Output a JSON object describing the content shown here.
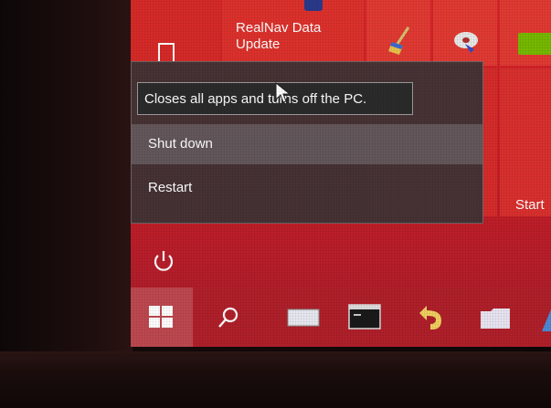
{
  "tiles": {
    "realnav_title_line1": "RealNav Data",
    "realnav_title_line2": "Update",
    "start_label": "Start"
  },
  "power_menu": {
    "tooltip": "Closes all apps and turns off the PC.",
    "items": [
      {
        "label": "Shut down"
      },
      {
        "label": "Restart"
      }
    ]
  },
  "icons": {
    "power": "power-icon",
    "start": "windows-logo-icon",
    "search": "search-icon",
    "task_view": "task-view-icon",
    "terminal": "terminal-icon",
    "back": "back-arrow-icon",
    "folder": "folder-icon"
  },
  "colors": {
    "accent": "#c81e24",
    "menu_bg": "#3c3436",
    "tooltip_bg": "#2b2b2b"
  }
}
